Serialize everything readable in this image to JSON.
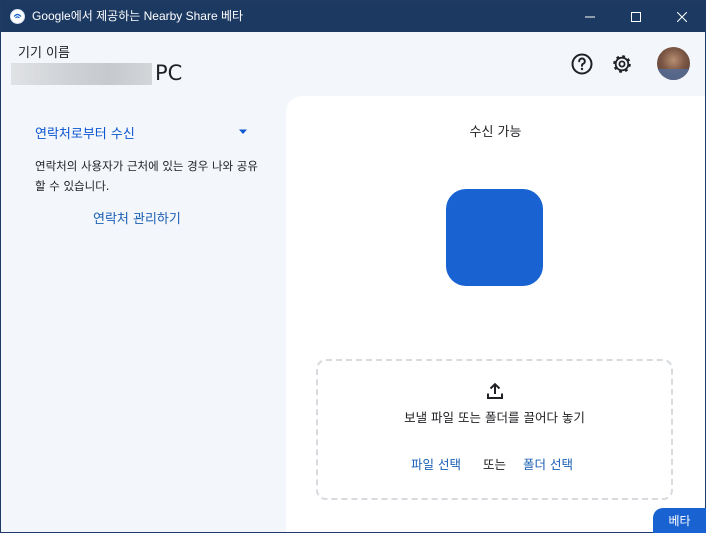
{
  "window": {
    "title": "Google에서 제공하는 Nearby Share 베타",
    "controls": [
      "minimize-icon",
      "maximize-icon",
      "close-icon"
    ]
  },
  "header": {
    "device_label": "기기 이름",
    "device_name_suffix": "PC",
    "icons": [
      "help-icon",
      "gear-icon",
      "avatar"
    ]
  },
  "sidebar": {
    "visibility_label": "연락처로부터 수신",
    "visibility_description": "연락처의 사용자가 근처에 있는 경우 나와 공유할 수 있습니다.",
    "manage_link": "연락처 관리하기"
  },
  "main": {
    "status": "수신 가능",
    "dropzone": {
      "text": "보낼 파일 또는 폴더를 끌어다 놓기",
      "file_button": "파일 선택",
      "or_text": "또는",
      "folder_button": "폴더 선택"
    }
  },
  "badge": "베타",
  "colors": {
    "titlebar": "#1c3962",
    "accent": "#1863d1",
    "link": "#1a5fb4",
    "background": "#f3f6fb"
  }
}
